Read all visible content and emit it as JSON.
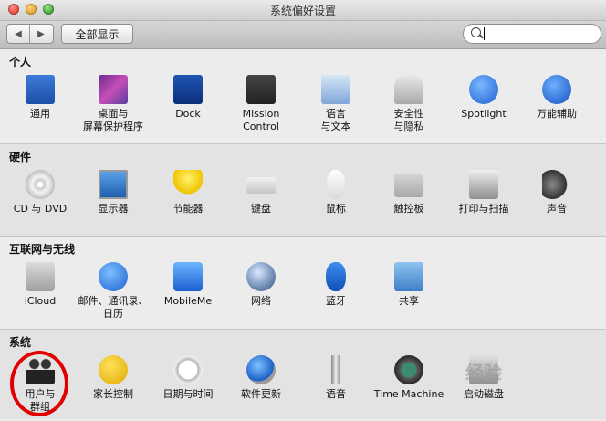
{
  "window": {
    "title": "系统偏好设置"
  },
  "toolbar": {
    "back": "◀",
    "forward": "▶",
    "show_all": "全部显示",
    "search_placeholder": ""
  },
  "sections": {
    "personal": {
      "title": "个人",
      "items": [
        "通用",
        "桌面与\n屏幕保护程序",
        "Dock",
        "Mission\nControl",
        "语言\n与文本",
        "安全性\n与隐私",
        "Spotlight",
        "万能辅助"
      ]
    },
    "hardware": {
      "title": "硬件",
      "items": [
        "CD 与 DVD",
        "显示器",
        "节能器",
        "键盘",
        "鼠标",
        "触控板",
        "打印与扫描",
        "声音"
      ]
    },
    "internet": {
      "title": "互联网与无线",
      "items": [
        "iCloud",
        "邮件、通讯录、\n日历",
        "MobileMe",
        "网络",
        "蓝牙",
        "共享"
      ]
    },
    "system": {
      "title": "系统",
      "items": [
        "用户与\n群组",
        "家长控制",
        "日期与时间",
        "软件更新",
        "语音",
        "Time Machine",
        "启动磁盘"
      ]
    }
  },
  "icons": {
    "personal": [
      "general-icon",
      "desktop-screensaver-icon",
      "dock-icon",
      "mission-control-icon",
      "language-text-icon",
      "security-privacy-icon",
      "spotlight-icon",
      "accessibility-icon"
    ],
    "hardware": [
      "cd-dvd-icon",
      "displays-icon",
      "energy-saver-icon",
      "keyboard-icon",
      "mouse-icon",
      "trackpad-icon",
      "print-scan-icon",
      "sound-icon"
    ],
    "internet": [
      "icloud-icon",
      "mail-contacts-calendars-icon",
      "mobileme-icon",
      "network-icon",
      "bluetooth-icon",
      "sharing-icon"
    ],
    "system": [
      "users-groups-icon",
      "parental-controls-icon",
      "date-time-icon",
      "software-update-icon",
      "speech-icon",
      "time-machine-icon",
      "startup-disk-icon"
    ]
  },
  "watermark": "经验",
  "colors": {
    "highlight_ring": "#e00000",
    "accent_blue": "#1a6fd6"
  }
}
